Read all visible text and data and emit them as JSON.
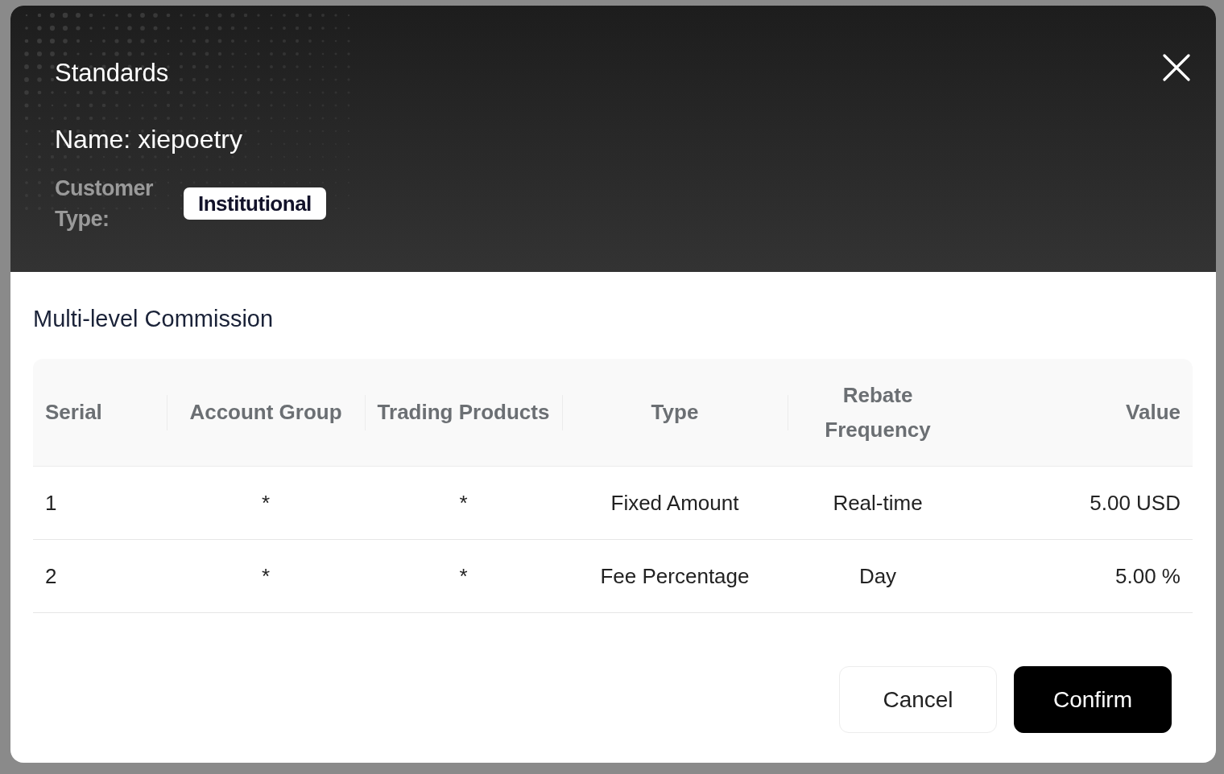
{
  "dialog": {
    "title": "Standards",
    "name_line": "Name: xiepoetry",
    "customer_type_label": "Customer Type:",
    "customer_type": "Institutional"
  },
  "section_title": "Multi-level Commission",
  "table": {
    "columns": [
      "Serial",
      "Account Group",
      "Trading Products",
      "Type",
      "Rebate Frequency",
      "Value"
    ],
    "rows": [
      [
        "1",
        "*",
        "*",
        "Fixed Amount",
        "Real-time",
        "5.00 USD"
      ],
      [
        "2",
        "*",
        "*",
        "Fee Percentage",
        "Day",
        "5.00 %"
      ]
    ]
  },
  "buttons": [
    {
      "label": "Cancel",
      "kind": "secondary"
    },
    {
      "label": "Confirm",
      "kind": "primary"
    }
  ]
}
